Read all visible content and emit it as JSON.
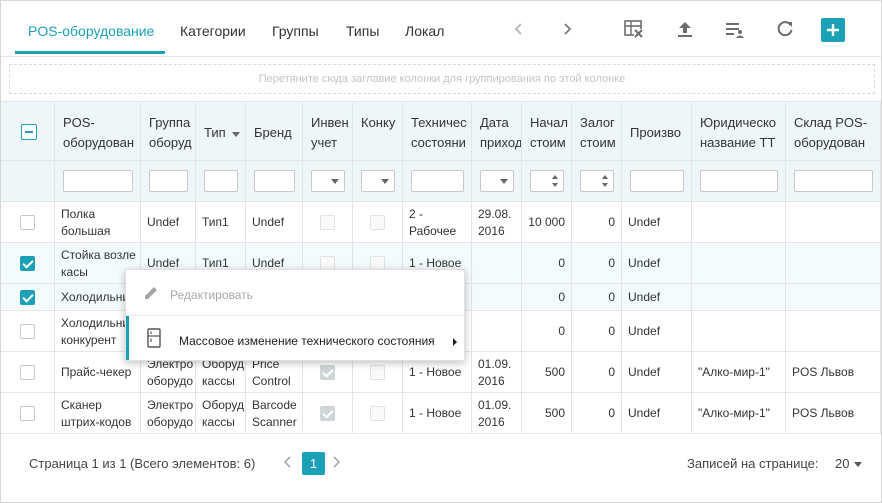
{
  "tabs": [
    {
      "label": "POS-оборудование",
      "active": true
    },
    {
      "label": "Категории"
    },
    {
      "label": "Группы"
    },
    {
      "label": "Типы"
    },
    {
      "label": "Локал"
    }
  ],
  "toolbar_icons": [
    "chevron-left-icon",
    "chevron-right-icon",
    "clear-filter-icon",
    "upload-icon",
    "column-chooser-icon",
    "refresh-icon",
    "add-icon"
  ],
  "group_panel_text": "Перетяните сюда заглавие колонки для группирования по этой колонке",
  "columns": [
    {
      "label1": "POS-",
      "label2": "оборудован"
    },
    {
      "label1": "Группа",
      "label2": "оборуд"
    },
    {
      "label1": "Тип",
      "label2": ""
    },
    {
      "label1": "Бренд",
      "label2": ""
    },
    {
      "label1": "Инвен",
      "label2": "учет"
    },
    {
      "label1": "Конку",
      "label2": ""
    },
    {
      "label1": "Техничес",
      "label2": "состояни"
    },
    {
      "label1": "Дата",
      "label2": "приход"
    },
    {
      "label1": "Начал",
      "label2": "стоим"
    },
    {
      "label1": "Залог",
      "label2": "стоим"
    },
    {
      "label1": "Произво",
      "label2": ""
    },
    {
      "label1": "Юридическо",
      "label2": "название ТТ"
    },
    {
      "label1": "Склад POS-",
      "label2": "оборудован"
    }
  ],
  "rows": [
    {
      "selected": false,
      "name1": "Полка",
      "name2": "большая",
      "group1": "Undef",
      "group2": "",
      "type1": "Тип1",
      "type2": "",
      "brand1": "Undef",
      "brand2": "",
      "inv": false,
      "comp": false,
      "state1": "2 -",
      "state2": "Рабочее",
      "date1": "29.08.",
      "date2": "2016",
      "cost": "10 000",
      "pledge": "0",
      "maker": "Undef",
      "legal": "",
      "store": ""
    },
    {
      "selected": true,
      "name1": "Стойка возле",
      "name2": "касы",
      "group1": "Undef",
      "group2": "",
      "type1": "Тип1",
      "type2": "",
      "brand1": "Undef",
      "brand2": "",
      "inv": false,
      "comp": false,
      "state1": "1 - Новое",
      "state2": "",
      "date1": "",
      "date2": "",
      "cost": "0",
      "pledge": "0",
      "maker": "Undef",
      "legal": "",
      "store": ""
    },
    {
      "selected": true,
      "name1": "Холодильни",
      "name2": "",
      "group1": "",
      "group2": "",
      "type1": "",
      "type2": "",
      "brand1": "",
      "brand2": "",
      "inv": false,
      "comp": false,
      "state1": "",
      "state2": "",
      "date1": "",
      "date2": "",
      "cost": "0",
      "pledge": "0",
      "maker": "Undef",
      "legal": "",
      "store": ""
    },
    {
      "selected": false,
      "name1": "Холодильни",
      "name2": "конкурент",
      "group1": "",
      "group2": "",
      "type1": "",
      "type2": "",
      "brand1": "",
      "brand2": "",
      "inv": false,
      "comp": false,
      "state1": "",
      "state2": "",
      "date1": "",
      "date2": "",
      "cost": "0",
      "pledge": "0",
      "maker": "Undef",
      "legal": "",
      "store": ""
    },
    {
      "selected": false,
      "name1": "Прайс-чекер",
      "name2": "",
      "group1": "Электро",
      "group2": "оборудо",
      "type1": "Оборуд",
      "type2": "кассы",
      "brand1": "Price",
      "brand2": "Control",
      "inv": true,
      "comp": false,
      "state1": "1 - Новое",
      "state2": "",
      "date1": "01.09.",
      "date2": "2016",
      "cost": "500",
      "pledge": "0",
      "maker": "Undef",
      "legal": "\"Алко-мир-1\"",
      "store": "POS Львов"
    },
    {
      "selected": false,
      "name1": "Сканер",
      "name2": "штрих-кодов",
      "group1": "Электро",
      "group2": "оборудо",
      "type1": "Оборуд",
      "type2": "кассы",
      "brand1": "Barcode",
      "brand2": "Scanner",
      "inv": true,
      "comp": false,
      "state1": "1 - Новое",
      "state2": "",
      "date1": "01.09.",
      "date2": "2016",
      "cost": "500",
      "pledge": "0",
      "maker": "Undef",
      "legal": "\"Алко-мир-1\"",
      "store": "POS Львов"
    }
  ],
  "context_menu": {
    "edit_label": "Редактировать",
    "mass_label": "Массовое изменение технического состояния"
  },
  "footer": {
    "page_info": "Страница 1 из 1 (Всего элементов: 6)",
    "current_page": "1",
    "per_page_label": "Записей на странице:",
    "per_page_value": "20"
  },
  "colors": {
    "accent": "#1ba0b6"
  }
}
